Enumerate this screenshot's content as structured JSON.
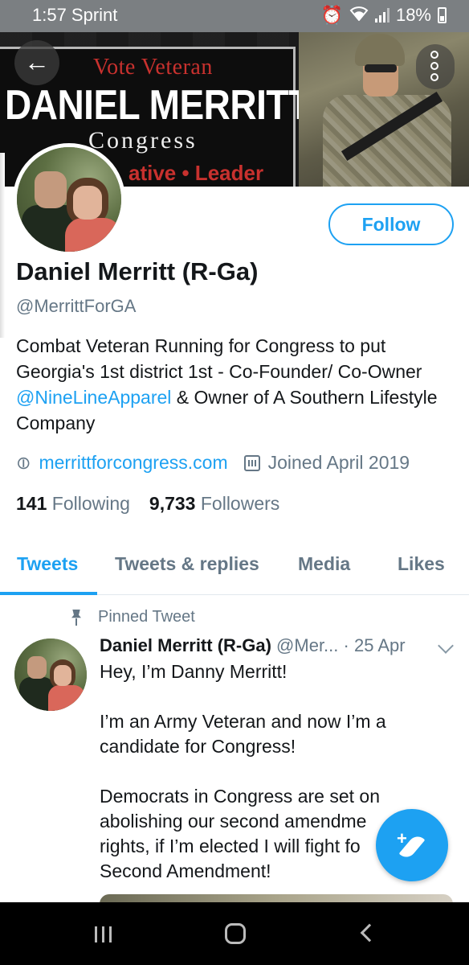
{
  "status_bar": {
    "time": "1:57 Sprint",
    "battery": "18%"
  },
  "banner": {
    "line1": "Vote Veteran",
    "line2": "DANIEL MERRITT",
    "line3": "Congress",
    "line4": "ative • Leader"
  },
  "profile": {
    "name": "Daniel Merritt (R-Ga)",
    "handle": "@MerrittForGA",
    "bio_part1": "Combat Veteran Running for Congress to put Georgia's 1st district 1st - Co-Founder/ Co-Owner ",
    "bio_mention": "@NineLineApparel",
    "bio_part2": " & Owner of A Southern Lifestyle Company",
    "website": "merrittforcongress.com",
    "joined": "Joined April 2019",
    "following_count": "141",
    "following_label": "Following",
    "followers_count": "9,733",
    "followers_label": "Followers"
  },
  "actions": {
    "follow_label": "Follow"
  },
  "tabs": [
    {
      "label": "Tweets"
    },
    {
      "label": "Tweets & replies"
    },
    {
      "label": "Media"
    },
    {
      "label": "Likes"
    }
  ],
  "tweet": {
    "pinned_label": "Pinned Tweet",
    "author_name": "Daniel Merritt (R-Ga)",
    "author_handle": "@Mer...",
    "date": "· 25 Apr",
    "paragraphs": [
      "Hey, I’m Danny Merritt!",
      "I’m an Army Veteran and now I’m a candidate for Congress!",
      "Democrats in Congress are set on abolishing our second amendme rights, if I’m elected I will fight fo Second Amendment!"
    ]
  },
  "fab": {
    "label": "+"
  },
  "colors": {
    "accent": "#1da1f2",
    "secondary_text": "#657786",
    "primary_text": "#14171a"
  },
  "icons": [
    "alarm-icon",
    "wifi-icon",
    "signal-icon",
    "battery-icon",
    "back-arrow-icon",
    "more-options-icon",
    "link-icon",
    "calendar-icon",
    "pin-icon",
    "chevron-down-icon",
    "compose-tweet-icon",
    "recents-icon",
    "home-icon",
    "nav-back-icon"
  ]
}
